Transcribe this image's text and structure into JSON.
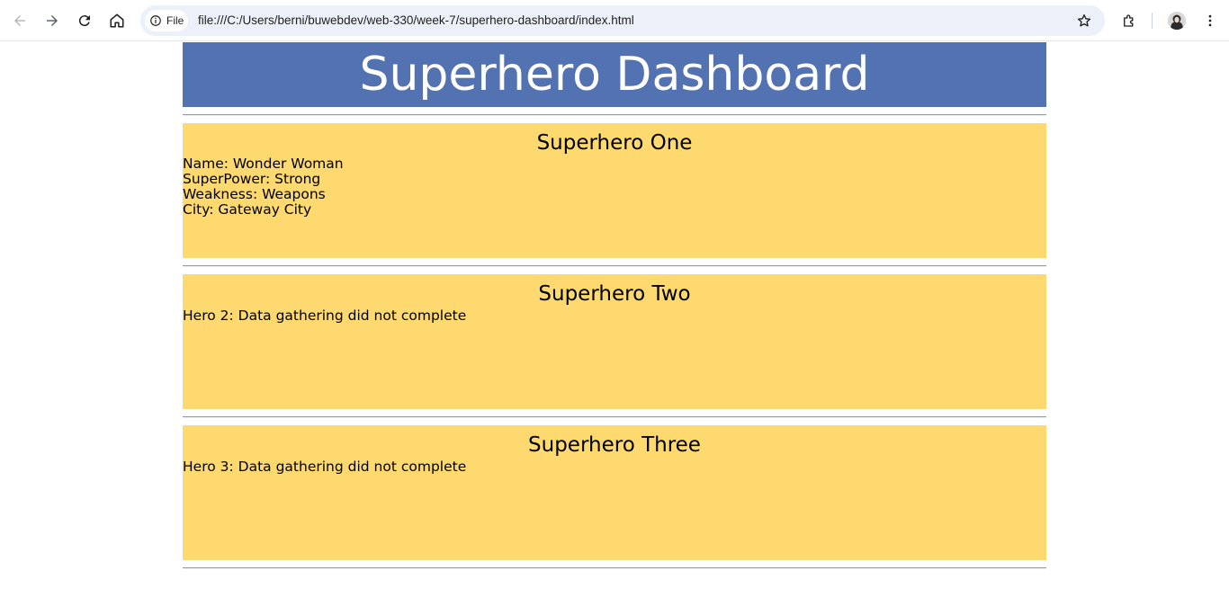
{
  "browser": {
    "site_chip_label": "File",
    "url": "file:///C:/Users/berni/buwebdev/web-330/week-7/superhero-dashboard/index.html",
    "icons": [
      "back-arrow-icon",
      "forward-arrow-icon",
      "reload-icon",
      "home-icon",
      "info-icon",
      "star-icon",
      "extensions-icon",
      "avatar",
      "kebab-menu-icon"
    ]
  },
  "header": {
    "title": "Superhero Dashboard",
    "bg_color": "#5372b2"
  },
  "cards": [
    {
      "heading": "Superhero One",
      "lines": [
        "Name: Wonder Woman",
        "SuperPower: Strong",
        "Weakness: Weapons",
        "City: Gateway City"
      ]
    },
    {
      "heading": "Superhero Two",
      "message": "Hero 2: Data gathering did not complete"
    },
    {
      "heading": "Superhero Three",
      "message": "Hero 3: Data gathering did not complete"
    }
  ],
  "colors": {
    "card_bg": "#fed970",
    "banner_bg": "#5372b2"
  }
}
